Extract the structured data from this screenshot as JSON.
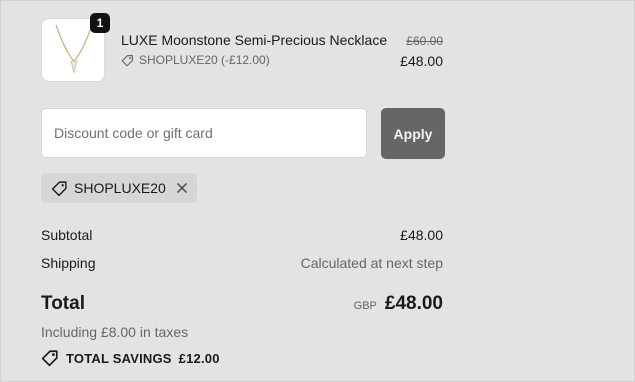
{
  "product": {
    "quantity": "1",
    "name": "LUXE Moonstone Semi-Precious Necklace",
    "discount_applied": "SHOPLUXE20 (-£12.00)",
    "original_price": "£60.00",
    "price": "£48.00",
    "thumbnail": "necklace-image"
  },
  "discount": {
    "placeholder": "Discount code or gift card",
    "value": "",
    "apply_label": "Apply",
    "applied_code": "SHOPLUXE20"
  },
  "summary": {
    "subtotal_label": "Subtotal",
    "subtotal_value": "£48.00",
    "shipping_label": "Shipping",
    "shipping_value": "Calculated at next step",
    "total_label": "Total",
    "currency": "GBP",
    "total_value": "£48.00",
    "taxes_note": "Including £8.00 in taxes",
    "savings_label": "TOTAL SAVINGS",
    "savings_value": "£12.00"
  },
  "colors": {
    "background": "#e3e3e1",
    "apply_button": "#666666",
    "chip": "#d6d6d4",
    "badge": "#111111"
  }
}
